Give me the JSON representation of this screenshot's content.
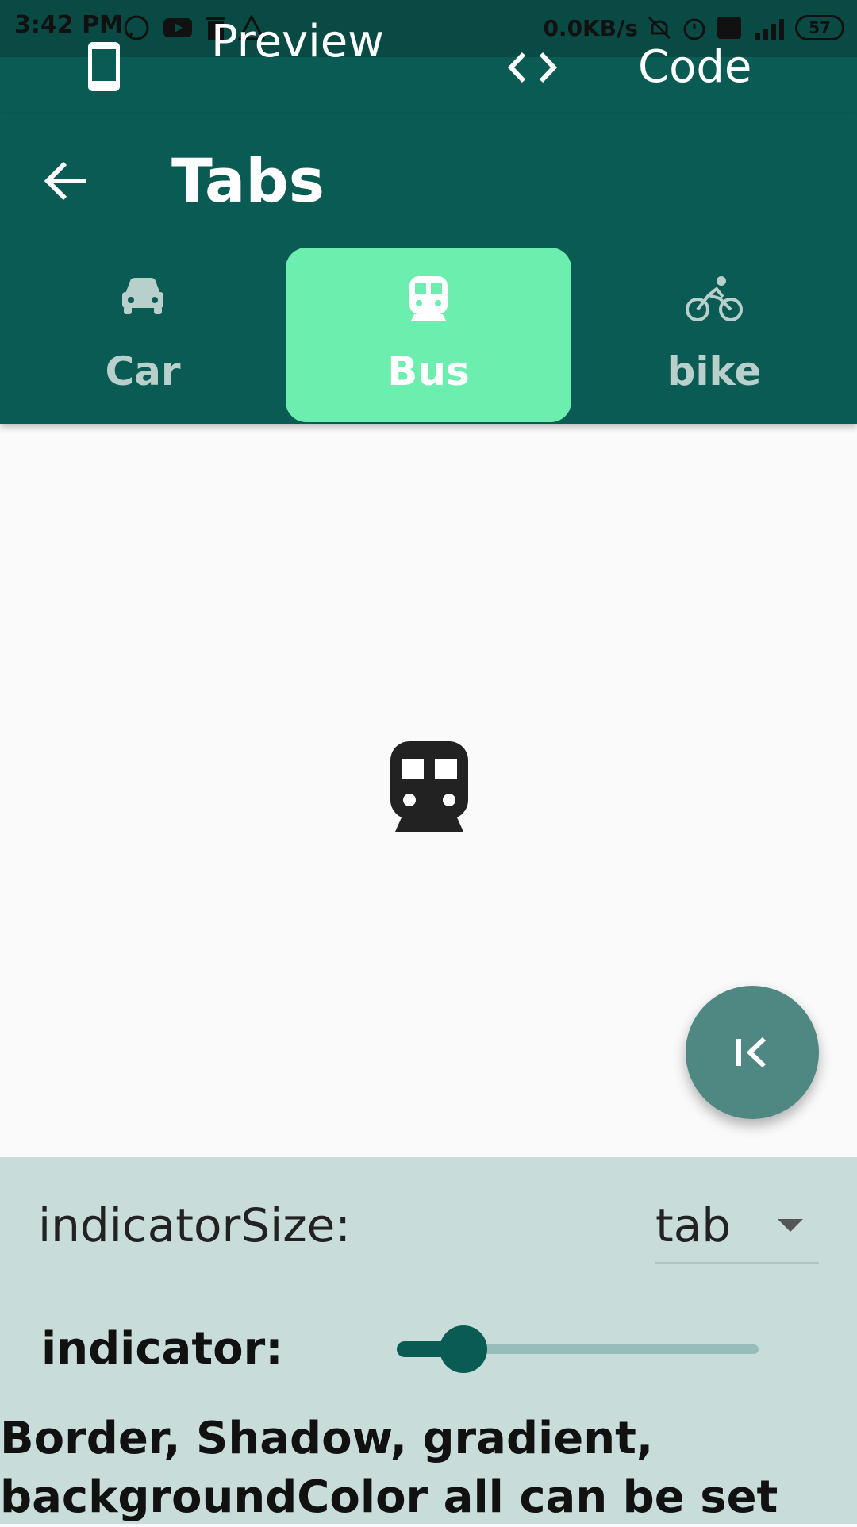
{
  "status_bar": {
    "time": "3:42 PM",
    "network_speed": "0.0KB/s",
    "battery_level": "57",
    "icons_left": [
      "whatsapp-icon",
      "youtube-icon",
      "trash-icon",
      "warning-icon"
    ],
    "icons_right": [
      "mute-icon",
      "alarm-icon",
      "volte-icon",
      "signal-4g-icon"
    ]
  },
  "top_toggle": {
    "preview_label": "Preview",
    "code_label": "Code"
  },
  "app_bar": {
    "title": "Tabs"
  },
  "tabs": [
    {
      "label": "Car",
      "icon": "car-icon",
      "selected": false
    },
    {
      "label": "Bus",
      "icon": "bus-icon",
      "selected": true
    },
    {
      "label": "bike",
      "icon": "bike-icon",
      "selected": false
    }
  ],
  "content": {
    "icon": "bus-icon"
  },
  "fab": {
    "icon": "first-page-icon"
  },
  "controls": {
    "indicator_size_label": "indicatorSize:",
    "indicator_size_value": "tab",
    "indicator_label": "indicator:",
    "indicator_value": 0.18,
    "note": "Border, Shadow, gradient, backgroundColor all can be set"
  },
  "colors": {
    "primary": "#0a5b54",
    "selected_tab": "#6ceeae",
    "panel": "#c8dcd9",
    "fab": "#4f8782"
  }
}
